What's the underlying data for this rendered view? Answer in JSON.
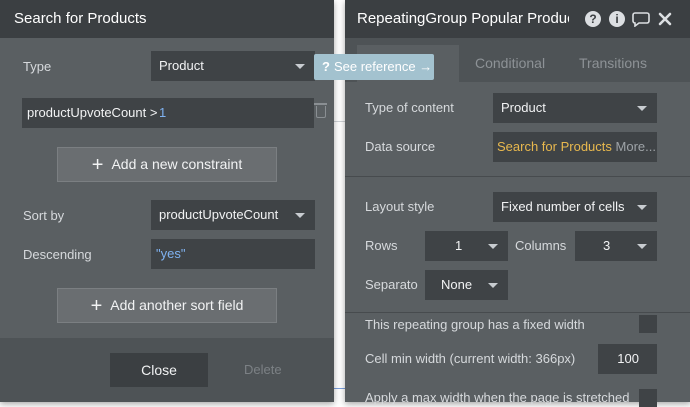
{
  "search_panel": {
    "title": "Search for Products",
    "type_label": "Type",
    "type_value": "Product",
    "constraint_field": "productUpvoteCount >",
    "constraint_value": "1",
    "add_constraint_label": "Add a new constraint",
    "sort_by_label": "Sort by",
    "sort_by_value": "productUpvoteCount",
    "descending_label": "Descending",
    "descending_value": "\"yes\"",
    "add_sort_label": "Add another sort field",
    "close_label": "Close",
    "delete_label": "Delete"
  },
  "tooltip": {
    "icon_glyph": "?",
    "text": "See reference →"
  },
  "property_panel": {
    "title": "RepeatingGroup Popular Products",
    "header_icons": [
      "help-icon",
      "info-icon",
      "comment-icon",
      "close-icon"
    ],
    "tabs": [
      {
        "label": "Appearance"
      },
      {
        "label": "Conditional"
      },
      {
        "label": "Transitions"
      }
    ],
    "active_tab_visible_text": "ce",
    "type_of_content_label": "Type of content",
    "type_of_content_value": "Product",
    "data_source_label": "Data source",
    "data_source_value": "Search for Products",
    "data_source_more": "More...",
    "layout_style_label": "Layout style",
    "layout_style_value": "Fixed number of cells",
    "rows_label": "Rows",
    "rows_value": "1",
    "columns_label": "Columns",
    "columns_value": "3",
    "separator_label": "Separato",
    "separator_value": "None",
    "fixed_width_label": "This repeating group has a fixed width",
    "cell_min_width_label": "Cell min width (current width: 366px)",
    "cell_min_width_value": "100",
    "max_width_label": "Apply a max width when the page is stretched"
  },
  "colors": {
    "panel_bg": "#5a5f62",
    "header_bg": "#3b3f42",
    "input_bg": "#3f4346",
    "link_blue": "#7fb2f0",
    "data_source_yellow": "#e8b84e",
    "tooltip_bg": "#a3c2cf"
  }
}
